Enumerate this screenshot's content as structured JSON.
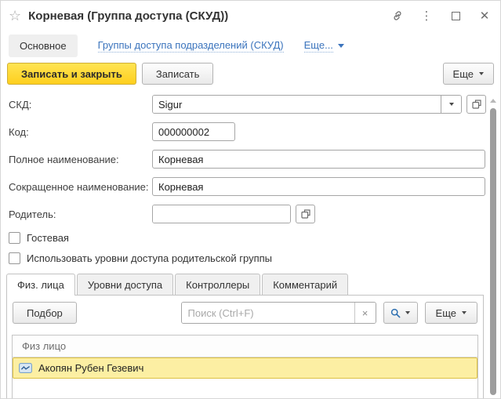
{
  "titlebar": {
    "title": "Корневая (Группа доступа (СКУД))",
    "star_glyph": "☆",
    "menu_glyph": "⋮",
    "close_glyph": "✕"
  },
  "nav": {
    "main_section": "Основное",
    "link": "Группы доступа подразделений (СКУД)",
    "more": "Еще..."
  },
  "command_bar": {
    "save_close": "Записать и закрыть",
    "save": "Записать",
    "more": "Еще"
  },
  "form": {
    "fields": [
      {
        "label": "СКД:",
        "value": "Sigur",
        "type": "combo"
      },
      {
        "label": "Код:",
        "value": "000000002",
        "type": "text"
      },
      {
        "label": "Полное наименование:",
        "value": "Корневая",
        "type": "text"
      },
      {
        "label": "Сокращенное наименование:",
        "value": "Корневая",
        "type": "text"
      },
      {
        "label": "Родитель:",
        "value": "",
        "type": "combo"
      }
    ],
    "checkboxes": [
      {
        "label": "Гостевая",
        "checked": false
      },
      {
        "label": "Использовать уровни доступа родительской группы",
        "checked": false
      }
    ]
  },
  "tabs": {
    "items": [
      {
        "label": "Физ. лица",
        "active": true
      },
      {
        "label": "Уровни доступа",
        "active": false
      },
      {
        "label": "Контроллеры",
        "active": false
      },
      {
        "label": "Комментарий",
        "active": false
      }
    ]
  },
  "panel": {
    "pick_button": "Подбор",
    "search_placeholder": "Поиск (Ctrl+F)",
    "clear_glyph": "×",
    "more": "Еще",
    "table": {
      "header": "Физ лицо",
      "rows": [
        {
          "name": "Акопян Рубен Гезевич",
          "selected": true
        }
      ]
    }
  },
  "icons": {
    "star-icon": "☆",
    "kebab-menu-icon": "⋮",
    "close-icon": "✕",
    "clear-icon": "×",
    "link-icon": "chain",
    "maximize-icon": "square",
    "open-picker-icon": "overlapping-squares",
    "search-icon": "magnifier",
    "person-record-icon": "wave-card"
  },
  "colors": {
    "primary_button": "#FFD629",
    "primary_button_border": "#CFAE35",
    "selection_row": "#FCEFA3",
    "selection_border": "#DCC042",
    "link_blue": "#3B74BD",
    "border_gray": "#A6A6A6"
  }
}
